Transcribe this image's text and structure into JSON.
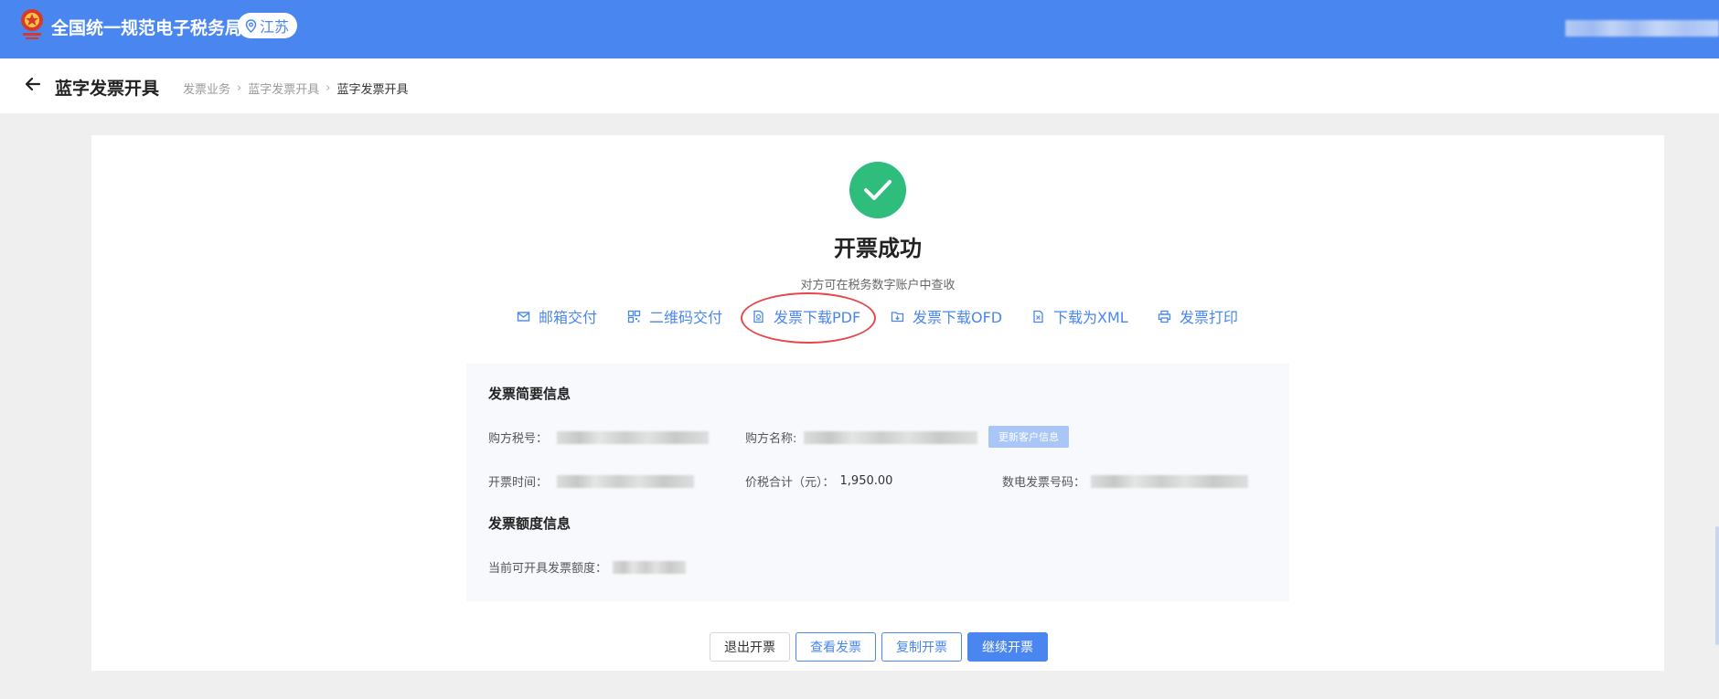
{
  "header": {
    "system_title": "全国统一规范电子税务局",
    "region": "江苏",
    "brand_color": "#4a86ef"
  },
  "breadcrumb_bar": {
    "page_title": "蓝字发票开具",
    "crumbs": [
      "发票业务",
      "蓝字发票开具",
      "蓝字发票开具"
    ]
  },
  "result": {
    "title": "开票成功",
    "subtitle": "对方可在税务数字账户中查收",
    "status_color": "#2ebd7c"
  },
  "actions": [
    {
      "label": "邮箱交付",
      "icon": "mail-icon"
    },
    {
      "label": "二维码交付",
      "icon": "qrcode-icon"
    },
    {
      "label": "发票下载PDF",
      "icon": "pdf-icon"
    },
    {
      "label": "发票下载OFD",
      "icon": "folder-download-icon"
    },
    {
      "label": "下载为XML",
      "icon": "xml-file-icon"
    },
    {
      "label": "发票打印",
      "icon": "printer-icon"
    }
  ],
  "summary": {
    "section_title": "发票简要信息",
    "buyer_tax_id_label": "购方税号：",
    "buyer_name_label": "购方名称:",
    "update_customer_label": "更新客户信息",
    "issue_time_label": "开票时间：",
    "total_label": "价税合计（元）：",
    "total_value": "1,950.00",
    "invoice_number_label": "数电发票号码："
  },
  "quota": {
    "section_title": "发票额度信息",
    "available_label": "当前可开具发票额度："
  },
  "buttons": {
    "exit": "退出开票",
    "view": "查看发票",
    "copy": "复制开票",
    "continue": "继续开票"
  }
}
